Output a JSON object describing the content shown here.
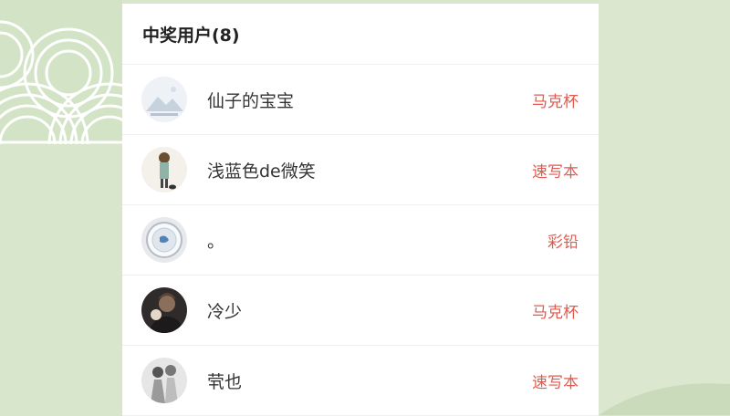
{
  "header": {
    "title": "中奖用户(8)"
  },
  "winners": [
    {
      "name": "仙子的宝宝",
      "prize": "马克杯",
      "avatar_icon": "mountain-landscape-avatar-icon"
    },
    {
      "name": "浅蓝色de微笑",
      "prize": "速写本",
      "avatar_icon": "anime-boy-with-cat-avatar-icon"
    },
    {
      "name": "。",
      "prize": "彩铅",
      "avatar_icon": "blue-fish-bowl-avatar-icon"
    },
    {
      "name": "冷少",
      "prize": "马克杯",
      "avatar_icon": "anime-hug-avatar-icon"
    },
    {
      "name": "茕也",
      "prize": "速写本",
      "avatar_icon": "sketch-characters-avatar-icon"
    }
  ],
  "colors": {
    "prize": "#e05a4e",
    "background": "#d8e6cc"
  }
}
